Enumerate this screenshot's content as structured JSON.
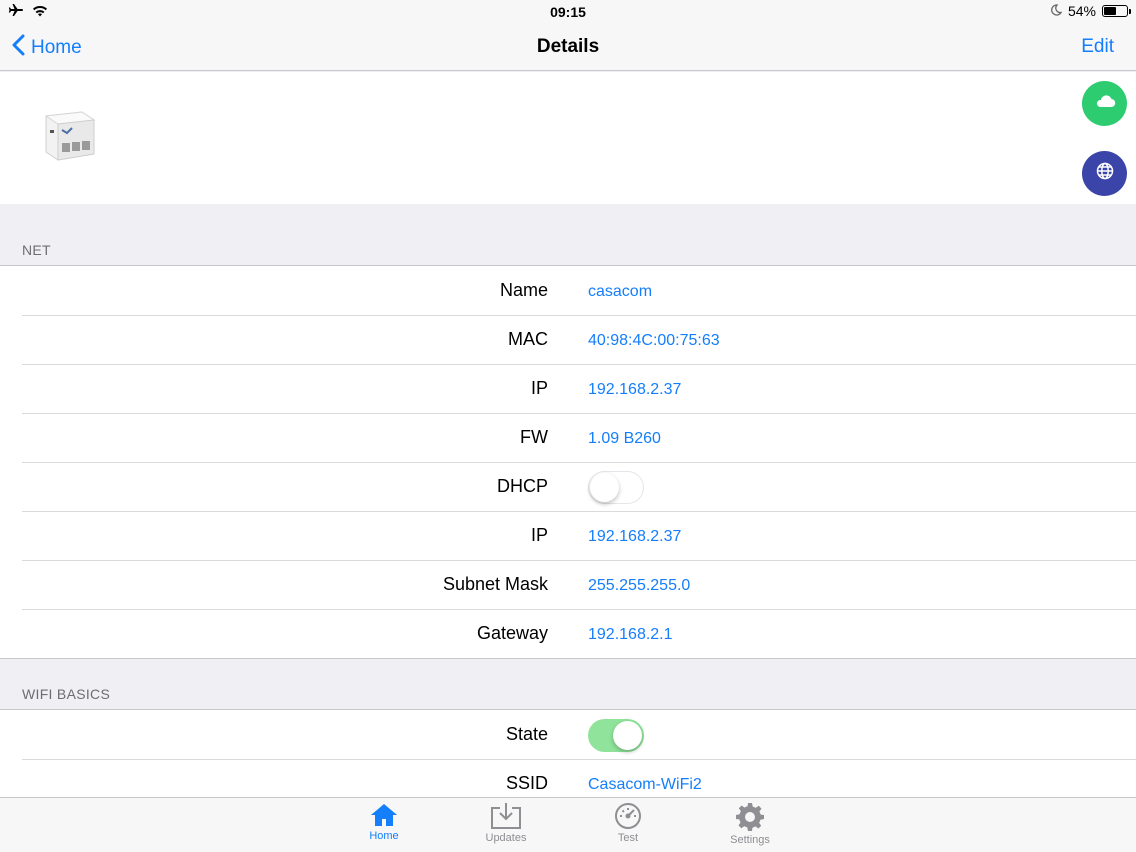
{
  "status_bar": {
    "time": "09:15",
    "battery": "54%",
    "battery_level": 0.54
  },
  "nav": {
    "back_label": "Home",
    "title": "Details",
    "edit_label": "Edit"
  },
  "header": {
    "cloud_color": "#2ecc71",
    "globe_color": "#3b44a8"
  },
  "sections": {
    "net": {
      "title": "NET",
      "rows": [
        {
          "label": "Name",
          "value": "casacom"
        },
        {
          "label": "MAC",
          "value": "40:98:4C:00:75:63"
        },
        {
          "label": "IP",
          "value": "192.168.2.37"
        },
        {
          "label": "FW",
          "value": "1.09 B260"
        },
        {
          "label": "DHCP",
          "toggle": false
        },
        {
          "label": "IP",
          "value": "192.168.2.37"
        },
        {
          "label": "Subnet Mask",
          "value": "255.255.255.0"
        },
        {
          "label": "Gateway",
          "value": "192.168.2.1"
        }
      ]
    },
    "wifi": {
      "title": "WIFI BASICS",
      "rows": [
        {
          "label": "State",
          "toggle": true
        },
        {
          "label": "SSID",
          "value": "Casacom-WiFi2"
        }
      ]
    }
  },
  "tabbar": {
    "tabs": [
      {
        "label": "Home",
        "icon": "house-icon",
        "active": true
      },
      {
        "label": "Updates",
        "icon": "download-tray-icon",
        "active": false
      },
      {
        "label": "Test",
        "icon": "speedometer-icon",
        "active": false
      },
      {
        "label": "Settings",
        "icon": "gear-icon",
        "active": false
      }
    ]
  },
  "colors": {
    "accent": "#147efb",
    "toggle_on": "#8fe39a"
  }
}
